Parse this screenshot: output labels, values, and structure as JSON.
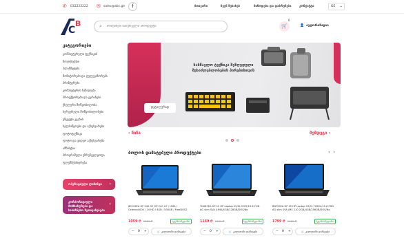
{
  "topbar": {
    "phone": "032222222",
    "email": "sales@abc.ge",
    "facebook_glyph": "f",
    "nav": [
      "მთავარი",
      "ჩვენ შესახებ",
      "მიწოდება და დაბრუნება",
      "კონტაქტი"
    ],
    "language": "GE"
  },
  "header": {
    "logo": "ABC",
    "search_placeholder": "მოძებნეთ სასურველი პროდუქტი",
    "cart_count": "0",
    "login_label": "ავტორიზაცია"
  },
  "sidebar": {
    "title": "კატეგორიები",
    "categories": [
      "კომპიუტერული ტექნიკის",
      "ნოუთბუქები",
      "პლანშეტები",
      "მონიტორები და ტელევიზორები",
      "პრინტერები",
      "კომპიუტერის ნაწილები",
      "პროექტორები და ეკრანები",
      "ქსელური მოწყობილობა",
      "სერვერული მოწყობილობები",
      "უწყვეტი კვების",
      "ხელსაწყოები და აქსესუარები",
      "ფოტოტექნიკა",
      "ფოტო და ვიდეო აქსესუარები",
      "ამნისტია",
      "პროგრამული უზრუნველყოფა",
      "ფლეშმეხსიერება"
    ],
    "promo1": "ოპერატიული ლიზინგი",
    "promo2": "კორპორაციული მომსახურება და საბიზნესო შეთავაზებები"
  },
  "banner": {
    "headline": "სასწავლო ტექნიკა შეზღუდული შესაძლებლობების პირებისთვის",
    "button": "დეტალურად"
  },
  "slider": {
    "prev": "წინა",
    "next": "შემდეგი"
  },
  "products": {
    "title": "ბოლოს დამატებული პროდუქტები",
    "stock_label": "ხელმისაწვდომია",
    "qty_value": "0",
    "add_label": "კალათაში დამატება",
    "items": [
      {
        "title": "6EC22EA HP 240 G7 HP 240 G7 / UMA / Celeron4000 / 14 HD / 4GB / 500GB / FreeDOS2",
        "price": "1059 ₾",
        "old_price": "1389 ₾"
      },
      {
        "title": "7N087EA HP 15 HP Laptop 15/i6-9225/15.6 FHD AG slim SVA /UMA/4GB/128GB/DOS/No",
        "price": "1169 ₾",
        "old_price": "1339 ₾"
      },
      {
        "title": "8NF55EA HP 15 HP Laptop 15/CI-7020U/15.6 FHD AG slim SVA /MX 110 2GB/4GB/256GB/DOS/No",
        "price": "1799 ₾",
        "old_price": "1989 ₾"
      }
    ]
  },
  "colors": {
    "accent": "#e53950",
    "banner_red": "#d6305a",
    "stock_green": "#2f9a47"
  }
}
